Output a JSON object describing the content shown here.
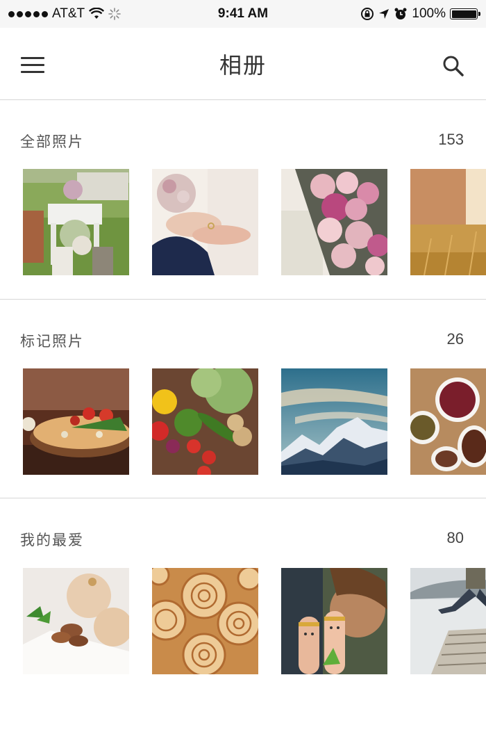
{
  "status_bar": {
    "carrier": "AT&T",
    "time": "9:41 AM",
    "battery": "100%"
  },
  "nav": {
    "title": "相册"
  },
  "albums": [
    {
      "title": "全部照片",
      "count": "153"
    },
    {
      "title": "标记照片",
      "count": "26"
    },
    {
      "title": "我的最爱",
      "count": "80"
    }
  ]
}
